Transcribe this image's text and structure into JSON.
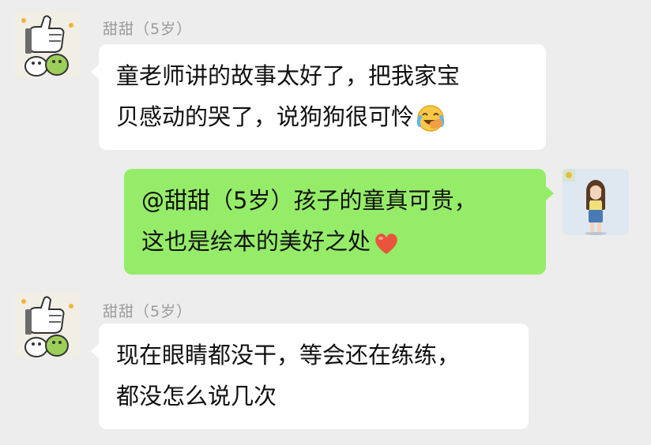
{
  "messages": [
    {
      "sender": "甜甜（5岁）",
      "lines": [
        "童老师讲的故事太好了，把我家宝",
        "贝感动的哭了，说狗狗很可怜"
      ],
      "emoji": "crying-laughing-emoji"
    },
    {
      "lines": [
        "@甜甜（5岁）孩子的童真可贵，",
        "这也是绘本的美好之处"
      ],
      "emoji": "heart-emoji"
    },
    {
      "sender": "甜甜（5岁）",
      "lines": [
        "现在眼睛都没干，等会还在练练，",
        "都没怎么说几次"
      ]
    }
  ],
  "colors": {
    "background": "#ededed",
    "incoming_bubble": "#ffffff",
    "outgoing_bubble": "#95ec69",
    "sender_name": "#9a9a9a",
    "heart": "#e8553c",
    "emoji_face": "#f7c948"
  }
}
